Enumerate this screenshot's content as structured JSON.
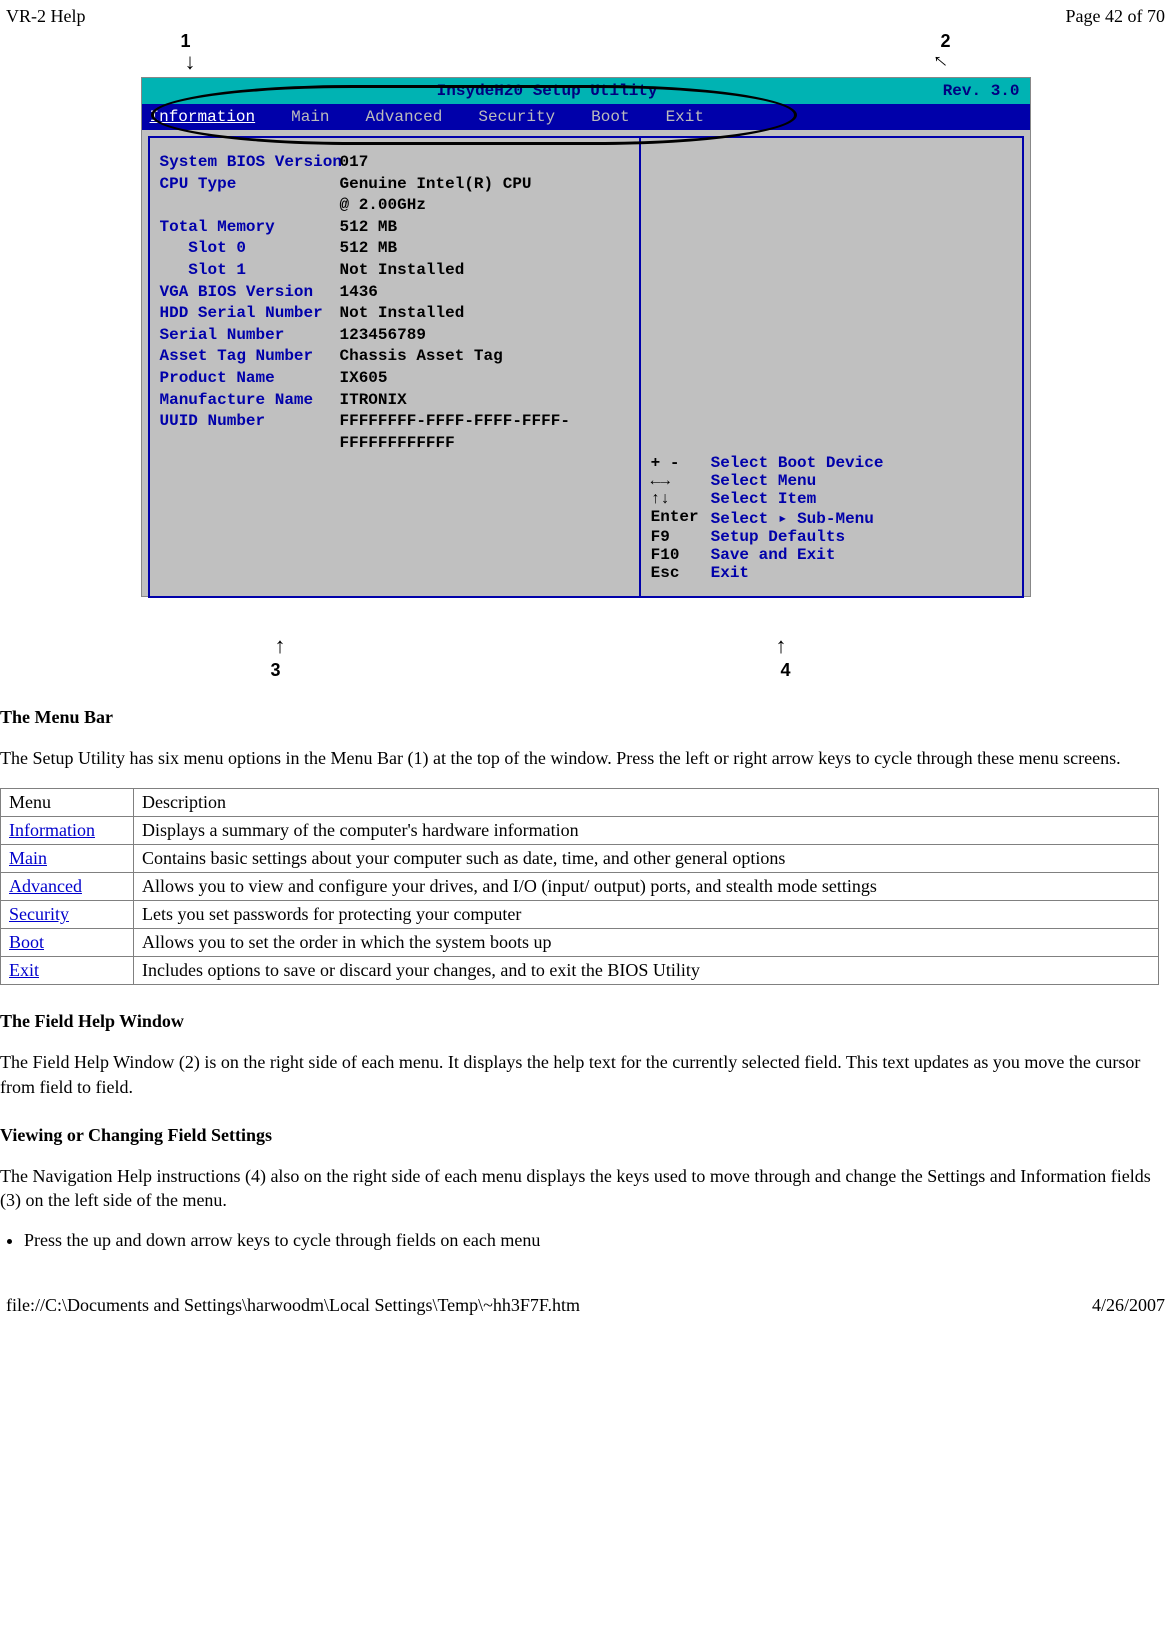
{
  "header": {
    "left": "VR-2 Help",
    "right": "Page 42 of 70"
  },
  "footer": {
    "left": "file://C:\\Documents and Settings\\harwoodm\\Local Settings\\Temp\\~hh3F7F.htm",
    "right": "4/26/2007"
  },
  "callouts": {
    "c1": "1",
    "c2": "2",
    "c3": "3",
    "c4": "4"
  },
  "bios": {
    "title_center": "InsydeH20 Setup Utility",
    "title_right": "Rev. 3.0",
    "menus": [
      "Information",
      "Main",
      "Advanced",
      "Security",
      "Boot",
      "Exit"
    ],
    "fields": [
      {
        "k": "System BIOS Version",
        "v": "017"
      },
      {
        "k": "",
        "v": ""
      },
      {
        "k": "CPU Type",
        "v": "Genuine Intel(R) CPU"
      },
      {
        "k": "",
        "v": "@ 2.00GHz"
      },
      {
        "k": "Total Memory",
        "v": "512 MB"
      },
      {
        "k": "   Slot 0",
        "v": "512 MB"
      },
      {
        "k": "   Slot 1",
        "v": "Not Installed"
      },
      {
        "k": "VGA BIOS Version",
        "v": "1436"
      },
      {
        "k": "HDD Serial Number",
        "v": "Not Installed"
      },
      {
        "k": "Serial Number",
        "v": "123456789"
      },
      {
        "k": "Asset Tag Number",
        "v": "Chassis Asset Tag"
      },
      {
        "k": "Product Name",
        "v": "IX605"
      },
      {
        "k": "Manufacture Name",
        "v": "ITRONIX"
      },
      {
        "k": "UUID Number",
        "v": "FFFFFFFF-FFFF-FFFF-FFFF-"
      },
      {
        "k": "",
        "v": "FFFFFFFFFFFF"
      }
    ],
    "nav": [
      {
        "k": "+ -",
        "v": "Select Boot Device"
      },
      {
        "k": "←→",
        "v": "Select Menu"
      },
      {
        "k": "↑↓",
        "v": "Select Item"
      },
      {
        "k": "Enter",
        "v": "Select ▸ Sub-Menu"
      },
      {
        "k": "F9",
        "v": "Setup Defaults"
      },
      {
        "k": "F10",
        "v": "Save and Exit"
      },
      {
        "k": "Esc",
        "v": "Exit"
      }
    ]
  },
  "sections": {
    "menu_bar_heading": "The Menu Bar",
    "menu_bar_para": "The Setup Utility has six menu options in the Menu Bar (1) at the top of the window. Press the left or right arrow keys to cycle through these menu screens.",
    "table_header": {
      "c1": "Menu",
      "c2": "Description"
    },
    "rows": [
      {
        "m": "Information",
        "d": "Displays a summary of the computer's hardware information"
      },
      {
        "m": "Main",
        "d": "Contains basic settings about your computer such as date, time, and other general options"
      },
      {
        "m": "Advanced",
        "d": "Allows you to view and configure your drives, and I/O (input/ output) ports, and stealth mode settings"
      },
      {
        "m": "Security",
        "d": "Lets you set passwords for protecting your computer"
      },
      {
        "m": "Boot",
        "d": "Allows you to set the order in which the system boots up"
      },
      {
        "m": "Exit",
        "d": "Includes options to save or discard your changes, and to exit the BIOS Utility"
      }
    ],
    "field_help_heading": "The Field Help Window",
    "field_help_para": "The Field Help Window (2)  is on the right side of each menu. It displays the help text for the currently selected field. This text updates as you move the cursor from field to field.",
    "view_change_heading": "Viewing or Changing Field Settings",
    "view_change_para": "The Navigation Help instructions (4) also on the right side of each menu displays the keys used to move through and change the Settings and Information fields  (3) on the left side of the menu.",
    "bullet_1": "Press the up and down arrow keys to cycle through fields on each menu"
  }
}
